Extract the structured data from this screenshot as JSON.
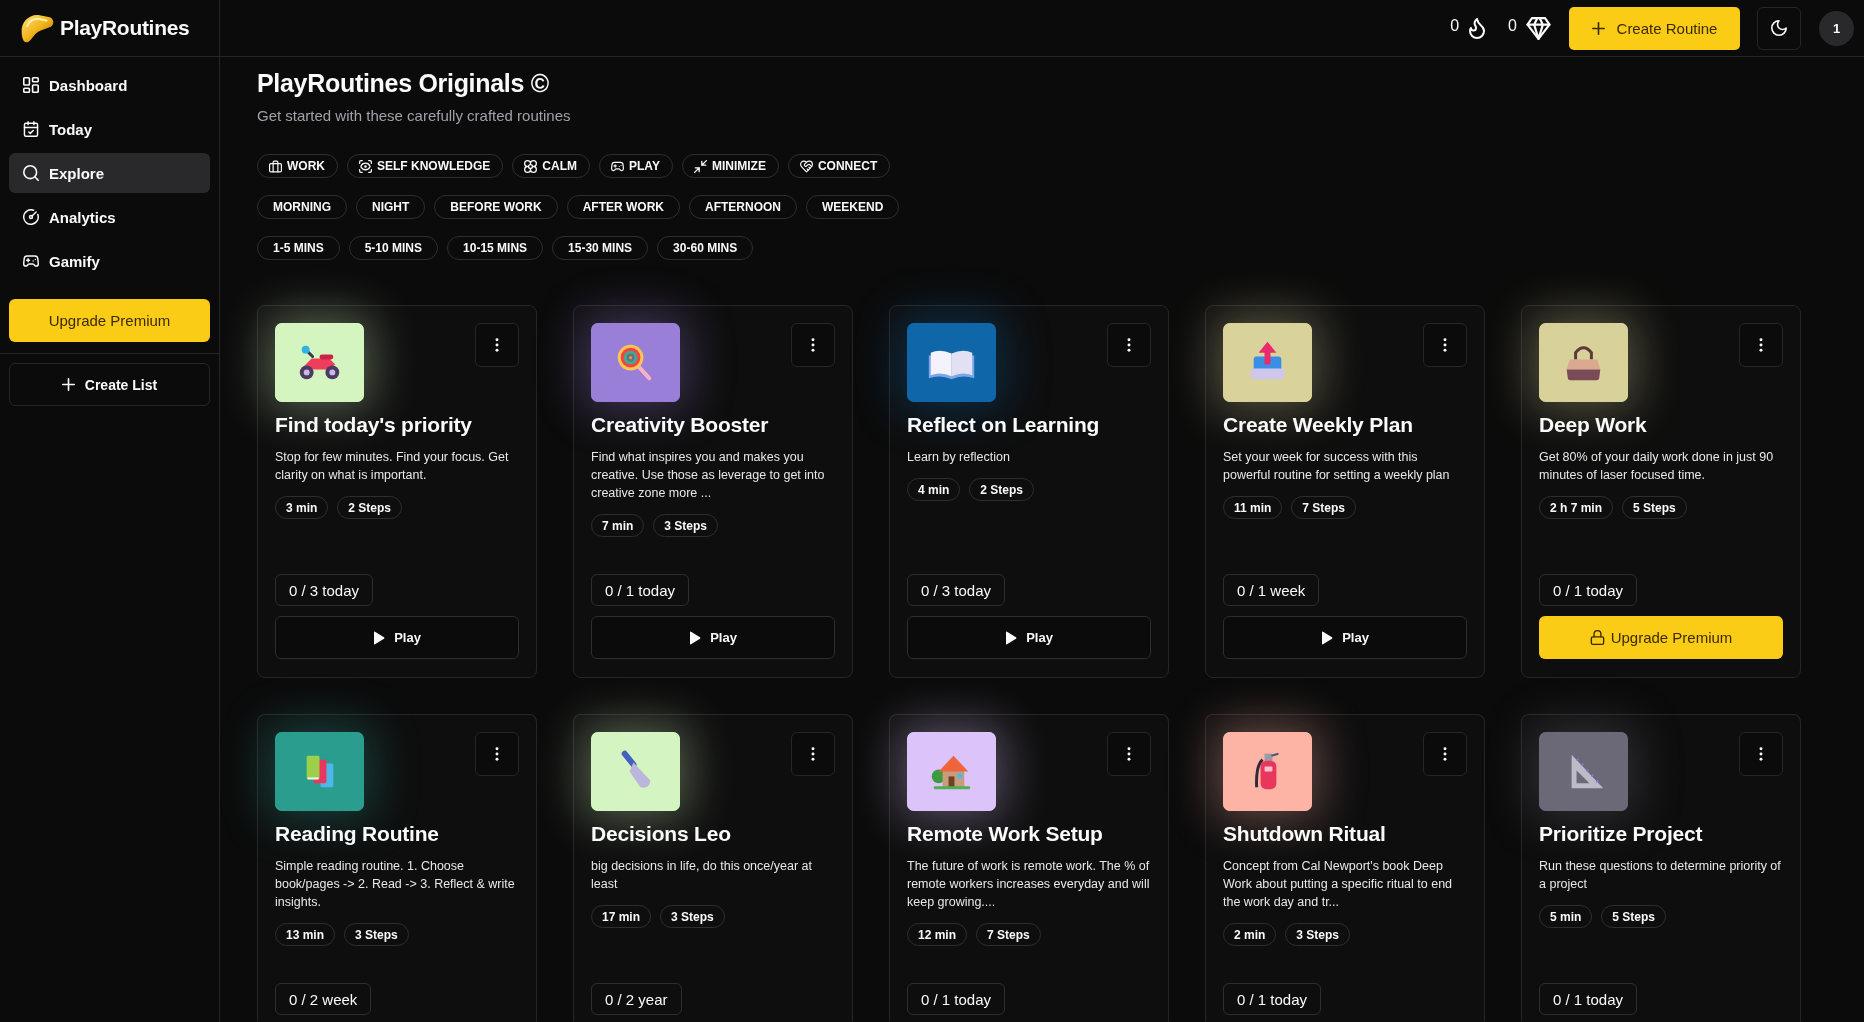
{
  "app": {
    "name": "PlayRoutines"
  },
  "sidebar": {
    "items": [
      {
        "label": "Dashboard",
        "selected": false
      },
      {
        "label": "Today",
        "selected": false
      },
      {
        "label": "Explore",
        "selected": true
      },
      {
        "label": "Analytics",
        "selected": false
      },
      {
        "label": "Gamify",
        "selected": false
      }
    ],
    "upgrade_button": "Upgrade Premium",
    "create_list_button": "Create List"
  },
  "header": {
    "streak": "0",
    "gems": "0",
    "create_button": "Create Routine",
    "avatar": "1"
  },
  "page": {
    "title": "PlayRoutines Originals ©",
    "subtitle": "Get started with these carefully crafted routines"
  },
  "filter_groups": [
    {
      "kind": "category",
      "chips": [
        {
          "label": "WORK",
          "selected": false
        },
        {
          "label": "SELF KNOWLEDGE",
          "selected": false
        },
        {
          "label": "CALM",
          "selected": false
        },
        {
          "label": "PLAY",
          "selected": false
        },
        {
          "label": "MINIMIZE",
          "selected": false
        },
        {
          "label": "CONNECT",
          "selected": false
        }
      ]
    },
    {
      "kind": "time",
      "chips": [
        {
          "label": "MORNING",
          "selected": false
        },
        {
          "label": "NIGHT",
          "selected": false
        },
        {
          "label": "BEFORE WORK",
          "selected": false
        },
        {
          "label": "AFTER WORK",
          "selected": false
        },
        {
          "label": "AFTERNOON",
          "selected": false
        },
        {
          "label": "WEEKEND",
          "selected": false
        }
      ]
    },
    {
      "kind": "duration",
      "chips": [
        {
          "label": "1-5 MINS",
          "selected": false
        },
        {
          "label": "5-10 MINS",
          "selected": false
        },
        {
          "label": "10-15 MINS",
          "selected": false
        },
        {
          "label": "15-30 MINS",
          "selected": false
        },
        {
          "label": "30-60 MINS",
          "selected": false
        }
      ]
    }
  ],
  "routines": [
    {
      "title": "Find today's priority",
      "description": "Stop for few minutes. Find your focus. Get clarity on what is important.",
      "duration": "3 min",
      "steps": "2 Steps",
      "progress": "0 / 3 today",
      "color": "#d4f5c0",
      "action": {
        "kind": "play",
        "label": "Play"
      }
    },
    {
      "title": "Creativity Booster",
      "description": "Find what inspires you and makes you creative. Use those as leverage to get into creative zone more ...",
      "duration": "7 min",
      "steps": "3 Steps",
      "progress": "0 / 1 today",
      "color": "#9a7fd8",
      "action": {
        "kind": "play",
        "label": "Play"
      }
    },
    {
      "title": "Reflect on Learning",
      "description": "Learn by reflection",
      "duration": "4 min",
      "steps": "2 Steps",
      "progress": "0 / 3 today",
      "color": "#0f66a8",
      "action": {
        "kind": "play",
        "label": "Play"
      }
    },
    {
      "title": "Create Weekly Plan",
      "description": "Set your week for success with this powerful routine for setting a weekly plan",
      "duration": "11 min",
      "steps": "7 Steps",
      "progress": "0 / 1 week",
      "color": "#d9d39b",
      "action": {
        "kind": "play",
        "label": "Play"
      }
    },
    {
      "title": "Deep Work",
      "description": "Get 80% of your daily work done in just 90 minutes of laser focused time.",
      "duration": "2 h 7 min",
      "steps": "5 Steps",
      "progress": "0 / 1 today",
      "color": "#d9d19a",
      "action": {
        "kind": "upgrade",
        "label": "Upgrade Premium"
      }
    },
    {
      "title": "Reading Routine",
      "description": "Simple reading routine. 1. Choose book/pages -> 2. Read -> 3. Reflect & write insights.",
      "duration": "13 min",
      "steps": "3 Steps",
      "progress": "0 / 2 week",
      "color": "#2a9d8f"
    },
    {
      "title": "Decisions Leo",
      "description": "big decisions in life, do this once/year at least",
      "duration": "17 min",
      "steps": "3 Steps",
      "progress": "0 / 2 year",
      "color": "#d4f5c1"
    },
    {
      "title": "Remote Work Setup",
      "description": "The future of work is remote work. The % of remote workers increases everyday and will keep growing....",
      "duration": "12 min",
      "steps": "7 Steps",
      "progress": "0 / 1 today",
      "color": "#dcc4fb"
    },
    {
      "title": "Shutdown Ritual",
      "description": "Concept from Cal Newport's book Deep Work about putting a specific ritual to end the work day and tr...",
      "duration": "2 min",
      "steps": "3 Steps",
      "progress": "0 / 1 today",
      "color": "#fdb4a4"
    },
    {
      "title": "Prioritize Project",
      "description": "Run these questions to determine priority of a project",
      "duration": "5 min",
      "steps": "5 Steps",
      "progress": "0 / 1 today",
      "color": "#6b6878"
    }
  ]
}
